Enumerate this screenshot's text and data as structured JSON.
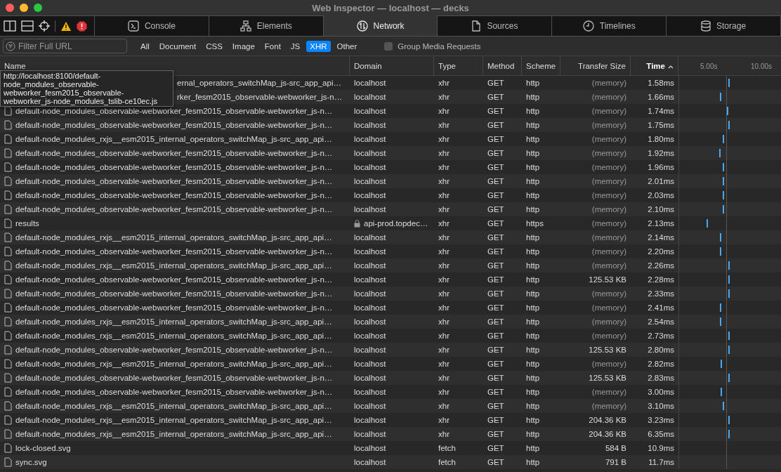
{
  "window": {
    "title": "Web Inspector — localhost — decks"
  },
  "tabs": [
    {
      "label": "Console",
      "selected": false
    },
    {
      "label": "Elements",
      "selected": false
    },
    {
      "label": "Network",
      "selected": true
    },
    {
      "label": "Sources",
      "selected": false
    },
    {
      "label": "Timelines",
      "selected": false
    },
    {
      "label": "Storage",
      "selected": false
    }
  ],
  "filter": {
    "placeholder": "Filter Full URL"
  },
  "type_filters": [
    {
      "label": "All",
      "selected": false
    },
    {
      "label": "Document",
      "selected": false
    },
    {
      "label": "CSS",
      "selected": false
    },
    {
      "label": "Image",
      "selected": false
    },
    {
      "label": "Font",
      "selected": false
    },
    {
      "label": "JS",
      "selected": false
    },
    {
      "label": "XHR",
      "selected": true
    },
    {
      "label": "Other",
      "selected": false
    }
  ],
  "group_media": {
    "label": "Group Media Requests",
    "checked": false
  },
  "table": {
    "columns": [
      {
        "label": "Name",
        "sorted": false
      },
      {
        "label": "Domain",
        "sorted": false
      },
      {
        "label": "Type",
        "sorted": false
      },
      {
        "label": "Method",
        "sorted": false
      },
      {
        "label": "Scheme",
        "sorted": false
      },
      {
        "label": "Transfer Size",
        "sorted": false
      },
      {
        "label": "Time",
        "sorted": true
      }
    ],
    "ticks": [
      "5.00s",
      "10.00s"
    ],
    "rows": [
      {
        "name": "ernal_operators_switchMap_js-src_app_api…",
        "clipped": true,
        "domain": "localhost",
        "secure": false,
        "type": "xhr",
        "method": "GET",
        "scheme": "http",
        "size": "(memory)",
        "time": "1.58ms",
        "level": 0.48
      },
      {
        "name": "rker_fesm2015_observable-webworker_js-n…",
        "clipped": true,
        "domain": "localhost",
        "secure": false,
        "type": "xhr",
        "method": "GET",
        "scheme": "http",
        "size": "(memory)",
        "time": "1.66ms",
        "level": 0.4
      },
      {
        "name": "default-node_modules_observable-webworker_fesm2015_observable-webworker_js-n…",
        "clipped": false,
        "domain": "localhost",
        "secure": false,
        "type": "xhr",
        "method": "GET",
        "scheme": "http",
        "size": "(memory)",
        "time": "1.74ms",
        "level": 0.47
      },
      {
        "name": "default-node_modules_observable-webworker_fesm2015_observable-webworker_js-n…",
        "clipped": false,
        "domain": "localhost",
        "secure": false,
        "type": "xhr",
        "method": "GET",
        "scheme": "http",
        "size": "(memory)",
        "time": "1.75ms",
        "level": 0.48
      },
      {
        "name": "default-node_modules_rxjs__esm2015_internal_operators_switchMap_js-src_app_api…",
        "clipped": false,
        "domain": "localhost",
        "secure": false,
        "type": "xhr",
        "method": "GET",
        "scheme": "http",
        "size": "(memory)",
        "time": "1.80ms",
        "level": 0.43
      },
      {
        "name": "default-node_modules_observable-webworker_fesm2015_observable-webworker_js-n…",
        "clipped": false,
        "domain": "localhost",
        "secure": false,
        "type": "xhr",
        "method": "GET",
        "scheme": "http",
        "size": "(memory)",
        "time": "1.92ms",
        "level": 0.39
      },
      {
        "name": "default-node_modules_observable-webworker_fesm2015_observable-webworker_js-n…",
        "clipped": false,
        "domain": "localhost",
        "secure": false,
        "type": "xhr",
        "method": "GET",
        "scheme": "http",
        "size": "(memory)",
        "time": "1.96ms",
        "level": 0.43
      },
      {
        "name": "default-node_modules_observable-webworker_fesm2015_observable-webworker_js-n…",
        "clipped": false,
        "domain": "localhost",
        "secure": false,
        "type": "xhr",
        "method": "GET",
        "scheme": "http",
        "size": "(memory)",
        "time": "2.01ms",
        "level": 0.43
      },
      {
        "name": "default-node_modules_observable-webworker_fesm2015_observable-webworker_js-n…",
        "clipped": false,
        "domain": "localhost",
        "secure": false,
        "type": "xhr",
        "method": "GET",
        "scheme": "http",
        "size": "(memory)",
        "time": "2.03ms",
        "level": 0.43
      },
      {
        "name": "default-node_modules_observable-webworker_fesm2015_observable-webworker_js-n…",
        "clipped": false,
        "domain": "localhost",
        "secure": false,
        "type": "xhr",
        "method": "GET",
        "scheme": "http",
        "size": "(memory)",
        "time": "2.10ms",
        "level": 0.43
      },
      {
        "name": "results",
        "clipped": false,
        "domain": "api-prod.topdec…",
        "secure": true,
        "type": "xhr",
        "method": "GET",
        "scheme": "https",
        "size": "(memory)",
        "time": "2.13ms",
        "level": 0.27
      },
      {
        "name": "default-node_modules_rxjs__esm2015_internal_operators_switchMap_js-src_app_api…",
        "clipped": false,
        "domain": "localhost",
        "secure": false,
        "type": "xhr",
        "method": "GET",
        "scheme": "http",
        "size": "(memory)",
        "time": "2.14ms",
        "level": 0.4
      },
      {
        "name": "default-node_modules_observable-webworker_fesm2015_observable-webworker_js-n…",
        "clipped": false,
        "domain": "localhost",
        "secure": false,
        "type": "xhr",
        "method": "GET",
        "scheme": "http",
        "size": "(memory)",
        "time": "2.20ms",
        "level": 0.4
      },
      {
        "name": "default-node_modules_rxjs__esm2015_internal_operators_switchMap_js-src_app_api…",
        "clipped": false,
        "domain": "localhost",
        "secure": false,
        "type": "xhr",
        "method": "GET",
        "scheme": "http",
        "size": "(memory)",
        "time": "2.26ms",
        "level": 0.48
      },
      {
        "name": "default-node_modules_observable-webworker_fesm2015_observable-webworker_js-n…",
        "clipped": false,
        "domain": "localhost",
        "secure": false,
        "type": "xhr",
        "method": "GET",
        "scheme": "http",
        "size": "125.53 KB",
        "time": "2.28ms",
        "level": 0.48
      },
      {
        "name": "default-node_modules_observable-webworker_fesm2015_observable-webworker_js-n…",
        "clipped": false,
        "domain": "localhost",
        "secure": false,
        "type": "xhr",
        "method": "GET",
        "scheme": "http",
        "size": "(memory)",
        "time": "2.33ms",
        "level": 0.48
      },
      {
        "name": "default-node_modules_observable-webworker_fesm2015_observable-webworker_js-n…",
        "clipped": false,
        "domain": "localhost",
        "secure": false,
        "type": "xhr",
        "method": "GET",
        "scheme": "http",
        "size": "(memory)",
        "time": "2.41ms",
        "level": 0.4
      },
      {
        "name": "default-node_modules_rxjs__esm2015_internal_operators_switchMap_js-src_app_api…",
        "clipped": false,
        "domain": "localhost",
        "secure": false,
        "type": "xhr",
        "method": "GET",
        "scheme": "http",
        "size": "(memory)",
        "time": "2.54ms",
        "level": 0.4
      },
      {
        "name": "default-node_modules_rxjs__esm2015_internal_operators_switchMap_js-src_app_api…",
        "clipped": false,
        "domain": "localhost",
        "secure": false,
        "type": "xhr",
        "method": "GET",
        "scheme": "http",
        "size": "(memory)",
        "time": "2.73ms",
        "level": 0.48
      },
      {
        "name": "default-node_modules_observable-webworker_fesm2015_observable-webworker_js-n…",
        "clipped": false,
        "domain": "localhost",
        "secure": false,
        "type": "xhr",
        "method": "GET",
        "scheme": "http",
        "size": "125.53 KB",
        "time": "2.80ms",
        "level": 0.48
      },
      {
        "name": "default-node_modules_rxjs__esm2015_internal_operators_switchMap_js-src_app_api…",
        "clipped": false,
        "domain": "localhost",
        "secure": false,
        "type": "xhr",
        "method": "GET",
        "scheme": "http",
        "size": "(memory)",
        "time": "2.82ms",
        "level": 0.41
      },
      {
        "name": "default-node_modules_observable-webworker_fesm2015_observable-webworker_js-n…",
        "clipped": false,
        "domain": "localhost",
        "secure": false,
        "type": "xhr",
        "method": "GET",
        "scheme": "http",
        "size": "125.53 KB",
        "time": "2.83ms",
        "level": 0.48
      },
      {
        "name": "default-node_modules_observable-webworker_fesm2015_observable-webworker_js-n…",
        "clipped": false,
        "domain": "localhost",
        "secure": false,
        "type": "xhr",
        "method": "GET",
        "scheme": "http",
        "size": "(memory)",
        "time": "3.00ms",
        "level": 0.41
      },
      {
        "name": "default-node_modules_rxjs__esm2015_internal_operators_switchMap_js-src_app_api…",
        "clipped": false,
        "domain": "localhost",
        "secure": false,
        "type": "xhr",
        "method": "GET",
        "scheme": "http",
        "size": "(memory)",
        "time": "3.10ms",
        "level": 0.43
      },
      {
        "name": "default-node_modules_rxjs__esm2015_internal_operators_switchMap_js-src_app_api…",
        "clipped": false,
        "domain": "localhost",
        "secure": false,
        "type": "xhr",
        "method": "GET",
        "scheme": "http",
        "size": "204.36 KB",
        "time": "3.23ms",
        "level": 0.48
      },
      {
        "name": "default-node_modules_rxjs__esm2015_internal_operators_switchMap_js-src_app_api…",
        "clipped": false,
        "domain": "localhost",
        "secure": false,
        "type": "xhr",
        "method": "GET",
        "scheme": "http",
        "size": "204.36 KB",
        "time": "6.35ms",
        "level": 0.48
      },
      {
        "name": "lock-closed.svg",
        "clipped": false,
        "domain": "localhost",
        "secure": false,
        "type": "fetch",
        "method": "GET",
        "scheme": "http",
        "size": "584 B",
        "time": "10.9ms"
      },
      {
        "name": "sync.svg",
        "clipped": false,
        "domain": "localhost",
        "secure": false,
        "type": "fetch",
        "method": "GET",
        "scheme": "http",
        "size": "791 B",
        "time": "11.7ms"
      }
    ]
  },
  "tooltip": {
    "lines": [
      "http://localhost:8100/default-",
      "node_modules_observable-",
      "webworker_fesm2015_observable-",
      "webworker_js-node_modules_tslib-ce10ec.js"
    ]
  }
}
